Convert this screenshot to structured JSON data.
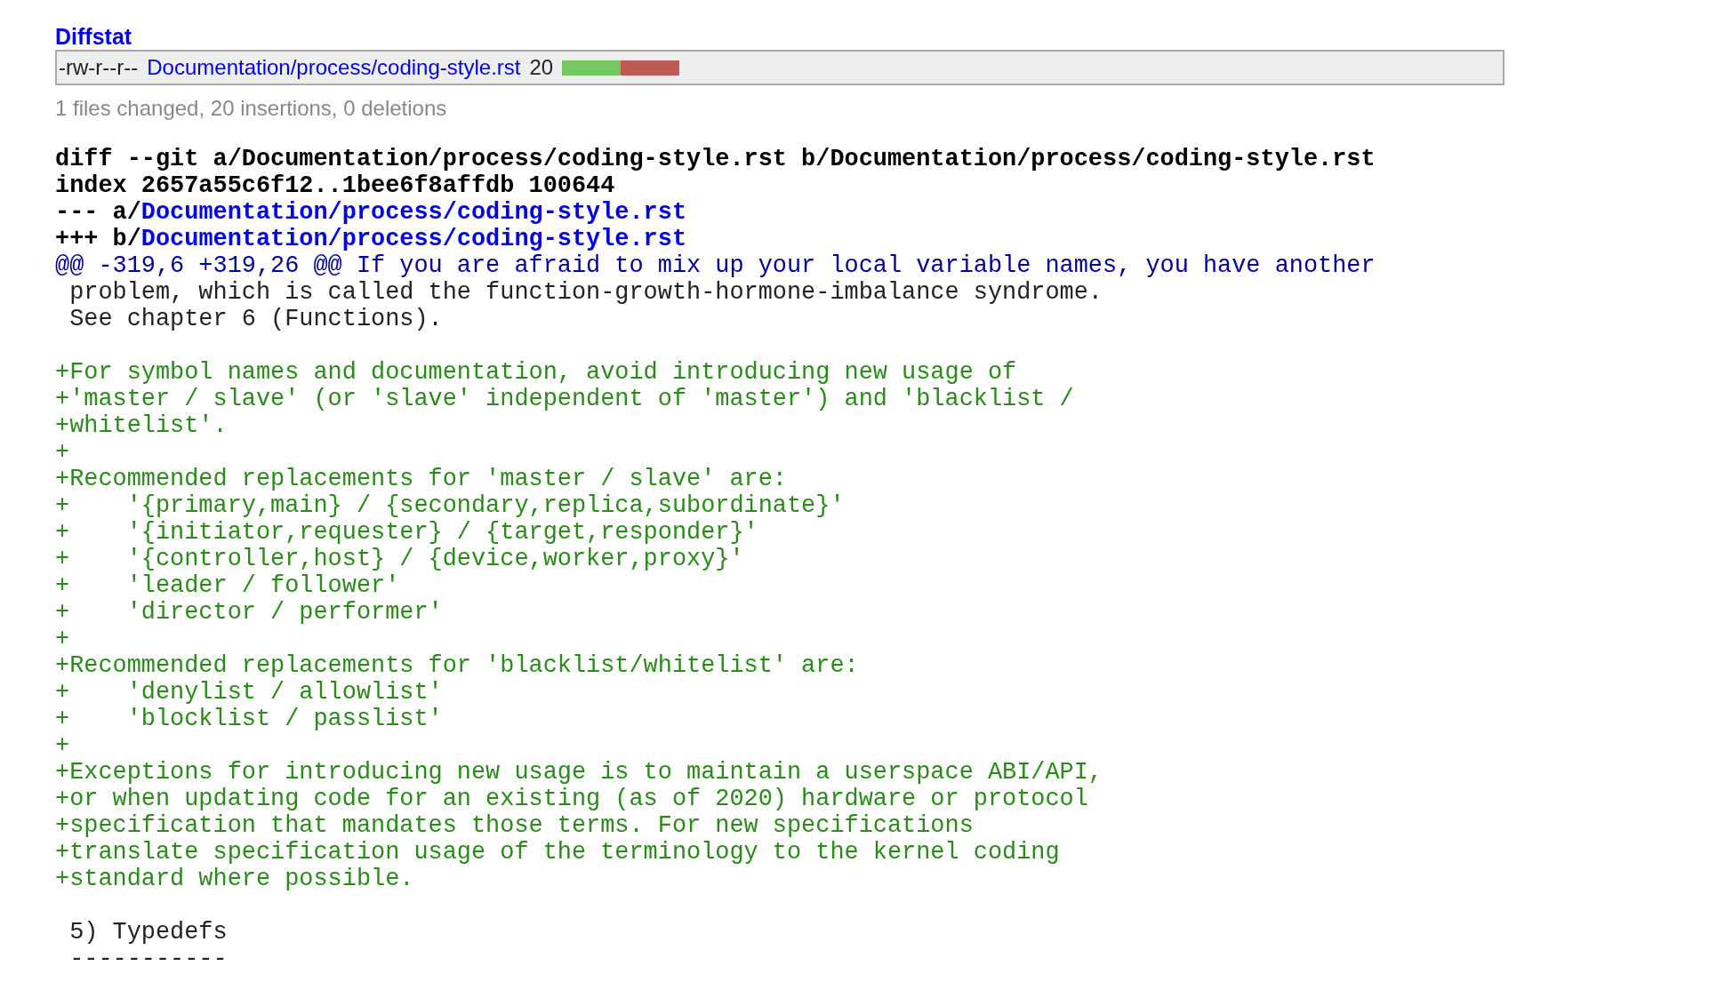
{
  "diffstat": {
    "title": "Diffstat",
    "files": [
      {
        "mode": "-rw-r--r--",
        "path": "Documentation/process/coding-style.rst",
        "count": "20",
        "bar": [
          {
            "kind": "add"
          },
          {
            "kind": "del"
          }
        ]
      }
    ],
    "summary": "1 files changed, 20 insertions, 0 deletions"
  },
  "diff": {
    "lines": [
      {
        "kind": "head",
        "text": "diff --git a/Documentation/process/coding-style.rst b/Documentation/process/coding-style.rst"
      },
      {
        "kind": "head",
        "text": "index 2657a55c6f12..1bee6f8affdb 100644"
      },
      {
        "kind": "file",
        "prefix": "--- a/",
        "link": "Documentation/process/coding-style.rst"
      },
      {
        "kind": "file",
        "prefix": "+++ b/",
        "link": "Documentation/process/coding-style.rst"
      },
      {
        "kind": "hunk",
        "text": "@@ -319,6 +319,26 @@ If you are afraid to mix up your local variable names, you have another"
      },
      {
        "kind": "ctx",
        "text": " problem, which is called the function-growth-hormone-imbalance syndrome."
      },
      {
        "kind": "ctx",
        "text": " See chapter 6 (Functions)."
      },
      {
        "kind": "blank"
      },
      {
        "kind": "add",
        "text": "+For symbol names and documentation, avoid introducing new usage of"
      },
      {
        "kind": "add",
        "text": "+'master / slave' (or 'slave' independent of 'master') and 'blacklist /"
      },
      {
        "kind": "add",
        "text": "+whitelist'."
      },
      {
        "kind": "add",
        "text": "+"
      },
      {
        "kind": "add",
        "text": "+Recommended replacements for 'master / slave' are:"
      },
      {
        "kind": "add",
        "text": "+    '{primary,main} / {secondary,replica,subordinate}'"
      },
      {
        "kind": "add",
        "text": "+    '{initiator,requester} / {target,responder}'"
      },
      {
        "kind": "add",
        "text": "+    '{controller,host} / {device,worker,proxy}'"
      },
      {
        "kind": "add",
        "text": "+    'leader / follower'"
      },
      {
        "kind": "add",
        "text": "+    'director / performer'"
      },
      {
        "kind": "add",
        "text": "+"
      },
      {
        "kind": "add",
        "text": "+Recommended replacements for 'blacklist/whitelist' are:"
      },
      {
        "kind": "add",
        "text": "+    'denylist / allowlist'"
      },
      {
        "kind": "add",
        "text": "+    'blocklist / passlist'"
      },
      {
        "kind": "add",
        "text": "+"
      },
      {
        "kind": "add",
        "text": "+Exceptions for introducing new usage is to maintain a userspace ABI/API,"
      },
      {
        "kind": "add",
        "text": "+or when updating code for an existing (as of 2020) hardware or protocol"
      },
      {
        "kind": "add",
        "text": "+specification that mandates those terms. For new specifications"
      },
      {
        "kind": "add",
        "text": "+translate specification usage of the terminology to the kernel coding"
      },
      {
        "kind": "add",
        "text": "+standard where possible."
      },
      {
        "kind": "blank"
      },
      {
        "kind": "ctx",
        "text": " 5) Typedefs"
      },
      {
        "kind": "ctx",
        "text": " -----------"
      }
    ]
  }
}
